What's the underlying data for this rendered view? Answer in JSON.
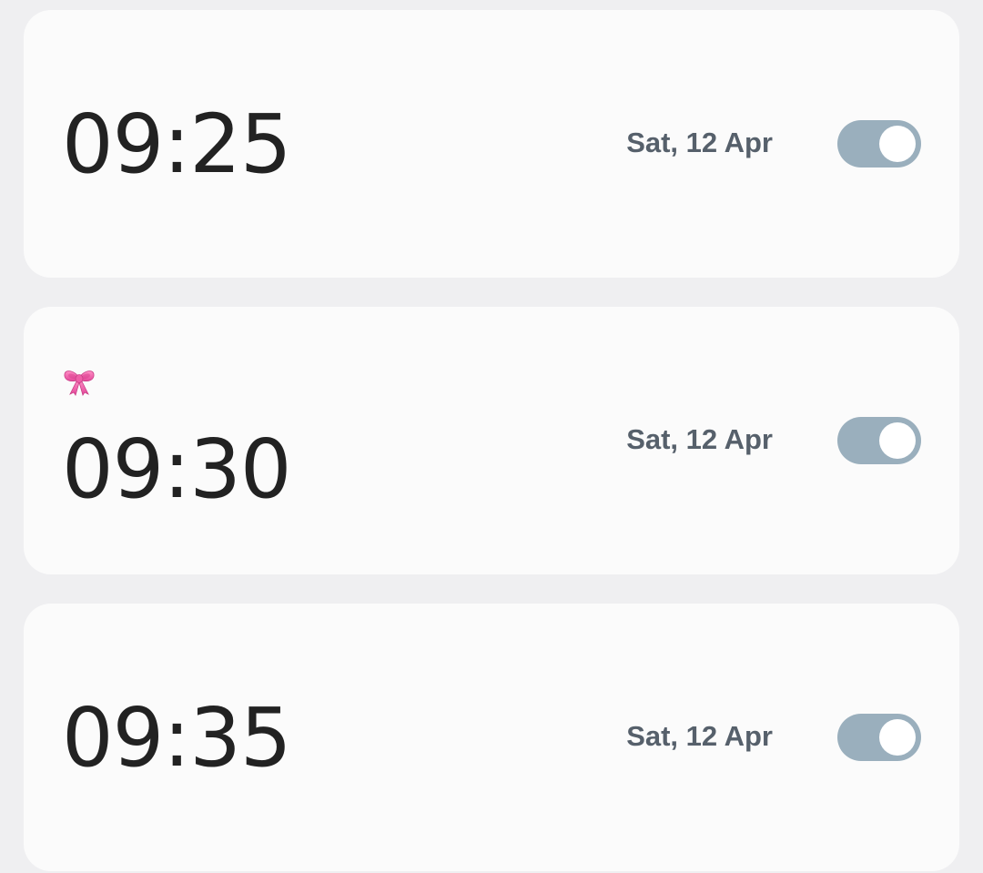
{
  "alarms": [
    {
      "time": "09:25",
      "date": "Sat, 12 Apr",
      "enabled": true,
      "label_icon": ""
    },
    {
      "time": "09:30",
      "date": "Sat, 12 Apr",
      "enabled": true,
      "label_icon": "ribbon-icon"
    },
    {
      "time": "09:35",
      "date": "Sat, 12 Apr",
      "enabled": true,
      "label_icon": ""
    }
  ],
  "colors": {
    "background": "#efeff1",
    "card": "#fbfbfb",
    "time_text": "#222222",
    "date_text": "#56606b",
    "toggle_track": "#9aafbd",
    "toggle_knob": "#ffffff",
    "ribbon": "#f46fae"
  }
}
